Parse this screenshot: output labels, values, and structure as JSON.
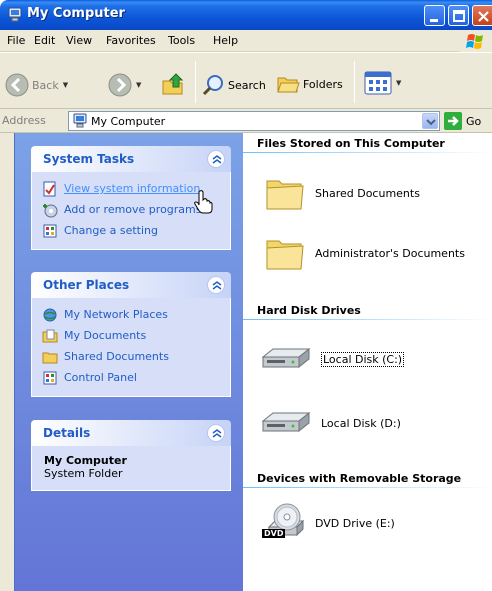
{
  "window": {
    "title": "My Computer"
  },
  "menu": [
    "File",
    "Edit",
    "View",
    "Favorites",
    "Tools",
    "Help"
  ],
  "toolbar": {
    "back_label": "Back",
    "search_label": "Search",
    "folders_label": "Folders"
  },
  "address": {
    "label": "Address",
    "value": "My Computer",
    "go_label": "Go"
  },
  "taskpane": {
    "system_tasks": {
      "title": "System Tasks",
      "items": [
        {
          "label": "View system information",
          "icon": "system-info-icon"
        },
        {
          "label": "Add or remove programs",
          "icon": "add-remove-programs-icon"
        },
        {
          "label": "Change a setting",
          "icon": "control-panel-icon"
        }
      ]
    },
    "other_places": {
      "title": "Other Places",
      "items": [
        {
          "label": "My Network Places",
          "icon": "network-places-icon"
        },
        {
          "label": "My Documents",
          "icon": "my-documents-icon"
        },
        {
          "label": "Shared Documents",
          "icon": "folder-icon"
        },
        {
          "label": "Control Panel",
          "icon": "control-panel-icon"
        }
      ]
    },
    "details": {
      "title": "Details",
      "name": "My Computer",
      "type": "System Folder"
    }
  },
  "content": {
    "groups": [
      {
        "title": "Files Stored on This Computer",
        "items": [
          {
            "label": "Shared Documents",
            "icon": "folder-icon"
          },
          {
            "label": "Administrator's Documents",
            "icon": "folder-icon"
          }
        ]
      },
      {
        "title": "Hard Disk Drives",
        "items": [
          {
            "label": "Local Disk (C:)",
            "icon": "hard-disk-icon"
          },
          {
            "label": "Local Disk (D:)",
            "icon": "hard-disk-icon"
          }
        ]
      },
      {
        "title": "Devices with Removable Storage",
        "items": [
          {
            "label": "DVD Drive (E:)",
            "icon": "dvd-drive-icon",
            "badge": "DVD"
          }
        ]
      }
    ]
  }
}
